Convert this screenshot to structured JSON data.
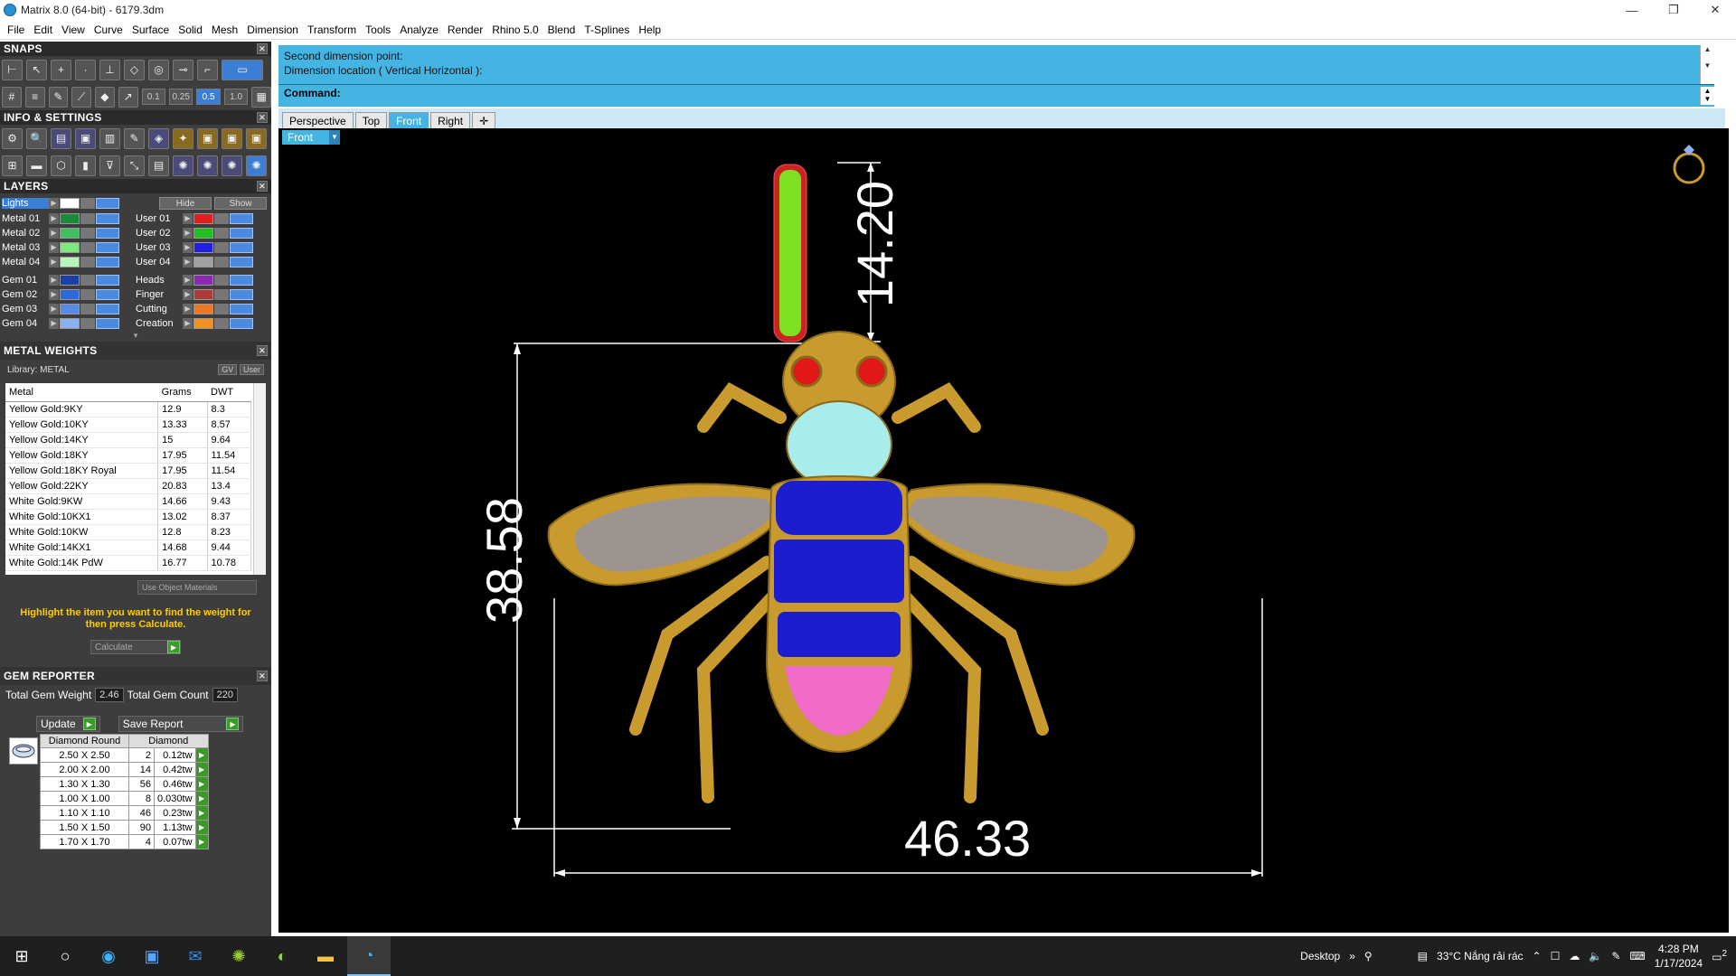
{
  "titlebar": {
    "title": "Matrix 8.0 (64-bit) - 6179.3dm",
    "minimize": "—",
    "restore": "❐",
    "close": "✕"
  },
  "menu": [
    "File",
    "Edit",
    "View",
    "Curve",
    "Surface",
    "Solid",
    "Mesh",
    "Dimension",
    "Transform",
    "Tools",
    "Analyze",
    "Render",
    "Rhino 5.0",
    "Blend",
    "T-Splines",
    "Help"
  ],
  "snaps": {
    "header": "SNAPS",
    "values": [
      "0.1",
      "0.25",
      "0.5",
      "1.0"
    ],
    "selected_value": "0.5"
  },
  "info_settings": {
    "header": "INFO & SETTINGS"
  },
  "layers": {
    "header": "LAYERS",
    "lights": "Lights",
    "hide": "Hide",
    "show": "Show",
    "left": [
      {
        "name": "Metal 01",
        "color": "#1a8a3a"
      },
      {
        "name": "Metal 02",
        "color": "#3fbf5f"
      },
      {
        "name": "Metal 03",
        "color": "#7ee87e"
      },
      {
        "name": "Metal 04",
        "color": "#b8f5b8"
      },
      {
        "name": "Gem 01",
        "color": "#1a3fa8"
      },
      {
        "name": "Gem 02",
        "color": "#2e68d8"
      },
      {
        "name": "Gem 03",
        "color": "#5a8ae8"
      },
      {
        "name": "Gem 04",
        "color": "#8ab0f0"
      }
    ],
    "right": [
      {
        "name": "User 01",
        "color": "#e02020"
      },
      {
        "name": "User 02",
        "color": "#20c020"
      },
      {
        "name": "User 03",
        "color": "#2020e0"
      },
      {
        "name": "User 04",
        "color": "#a0a0a0"
      },
      {
        "name": "Heads",
        "color": "#8a2ab0"
      },
      {
        "name": "Finger",
        "color": "#b03a3a"
      },
      {
        "name": "Cutting",
        "color": "#f07820"
      },
      {
        "name": "Creation",
        "color": "#f09020"
      }
    ]
  },
  "metal_weights": {
    "header": "METAL WEIGHTS",
    "library": "Library: METAL",
    "gv": "GV",
    "user": "User",
    "columns": [
      "Metal",
      "Grams",
      "DWT"
    ],
    "rows": [
      [
        "Yellow Gold:9KY",
        "12.9",
        "8.3"
      ],
      [
        "Yellow Gold:10KY",
        "13.33",
        "8.57"
      ],
      [
        "Yellow Gold:14KY",
        "15",
        "9.64"
      ],
      [
        "Yellow Gold:18KY",
        "17.95",
        "11.54"
      ],
      [
        "Yellow Gold:18KY Royal",
        "17.95",
        "11.54"
      ],
      [
        "Yellow Gold:22KY",
        "20.83",
        "13.4"
      ],
      [
        "White Gold:9KW",
        "14.66",
        "9.43"
      ],
      [
        "White Gold:10KX1",
        "13.02",
        "8.37"
      ],
      [
        "White Gold:10KW",
        "12.8",
        "8.23"
      ],
      [
        "White Gold:14KX1",
        "14.68",
        "9.44"
      ],
      [
        "White Gold:14K PdW",
        "16.77",
        "10.78"
      ]
    ],
    "use_object_materials": "Use Object Materials",
    "hint": "Highlight the item you want to find the weight for then press Calculate.",
    "calculate": "Calculate"
  },
  "gem_reporter": {
    "header": "GEM REPORTER",
    "total_weight_label": "Total Gem Weight",
    "total_weight": "2.46",
    "total_count_label": "Total Gem Count",
    "total_count": "220",
    "update": "Update",
    "save_report": "Save Report",
    "columns": [
      "Diamond Round",
      "Diamond"
    ],
    "rows": [
      [
        "2.50 X 2.50",
        "2",
        "0.12tw"
      ],
      [
        "2.00 X 2.00",
        "14",
        "0.42tw"
      ],
      [
        "1.30 X 1.30",
        "56",
        "0.46tw"
      ],
      [
        "1.00 X 1.00",
        "8",
        "0.030tw"
      ],
      [
        "1.10 X 1.10",
        "46",
        "0.23tw"
      ],
      [
        "1.50 X 1.50",
        "90",
        "1.13tw"
      ],
      [
        "1.70 X 1.70",
        "4",
        "0.07tw"
      ]
    ]
  },
  "command": {
    "line1": "Second dimension point:",
    "line2": "Dimension location ( Vertical  Horizontal ):",
    "prompt": "Command:"
  },
  "viewtabs": [
    "Perspective",
    "Top",
    "Front",
    "Right"
  ],
  "active_tab": "Front",
  "viewport": {
    "label": "Front",
    "dim_height_bail": "14.20",
    "dim_height_body": "38.58",
    "dim_width": "46.33"
  },
  "taskbar": {
    "desktop": "Desktop",
    "weather": "33°C  Nắng rải rác",
    "time": "4:28 PM",
    "date": "1/17/2024",
    "notif": "2"
  }
}
